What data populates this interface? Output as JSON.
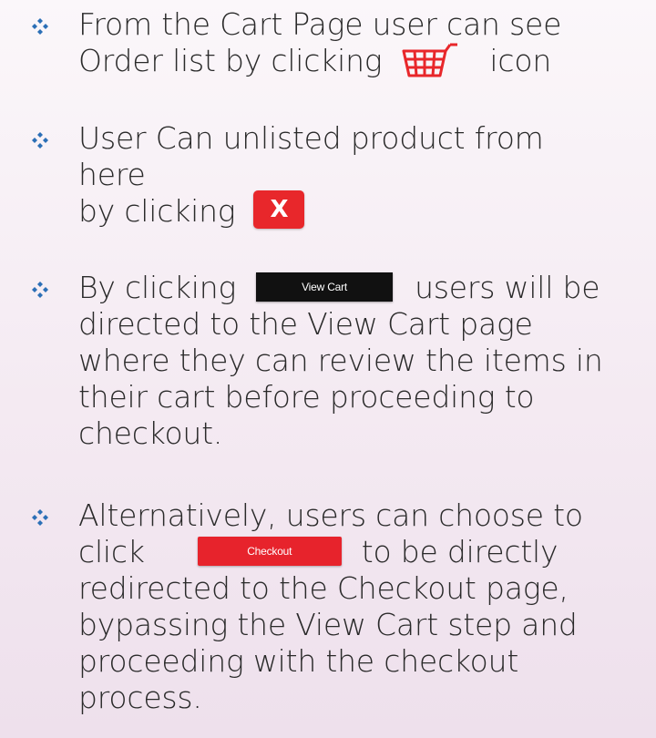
{
  "colors": {
    "diamond": "#2b6fb6",
    "cart_icon": "#e8272b",
    "x_badge": "#e8272b",
    "view_cart_button": "#111111",
    "checkout_button": "#e7232c"
  },
  "icons": {
    "bullet": "diamond-bullet-icon",
    "cart": "shopping-cart-icon"
  },
  "bullets": [
    {
      "line1": "From the Cart Page user can see",
      "line2_before": "Order list by clicking",
      "line2_after": "icon"
    },
    {
      "line1": "User Can unlisted product from here",
      "line2_before": "by clicking",
      "badge": "X"
    },
    {
      "before": "By clicking",
      "button": "View Cart",
      "after": "users will be",
      "rest": [
        "directed to the View Cart page",
        "where they can review the items in",
        "their cart before proceeding to",
        "checkout."
      ]
    },
    {
      "line1": "Alternatively, users can choose to",
      "before": "click",
      "button": "Checkout",
      "after": "to be directly",
      "rest": [
        "redirected to the Checkout page,",
        "bypassing the View Cart step and",
        "proceeding with the checkout",
        "process."
      ]
    }
  ]
}
